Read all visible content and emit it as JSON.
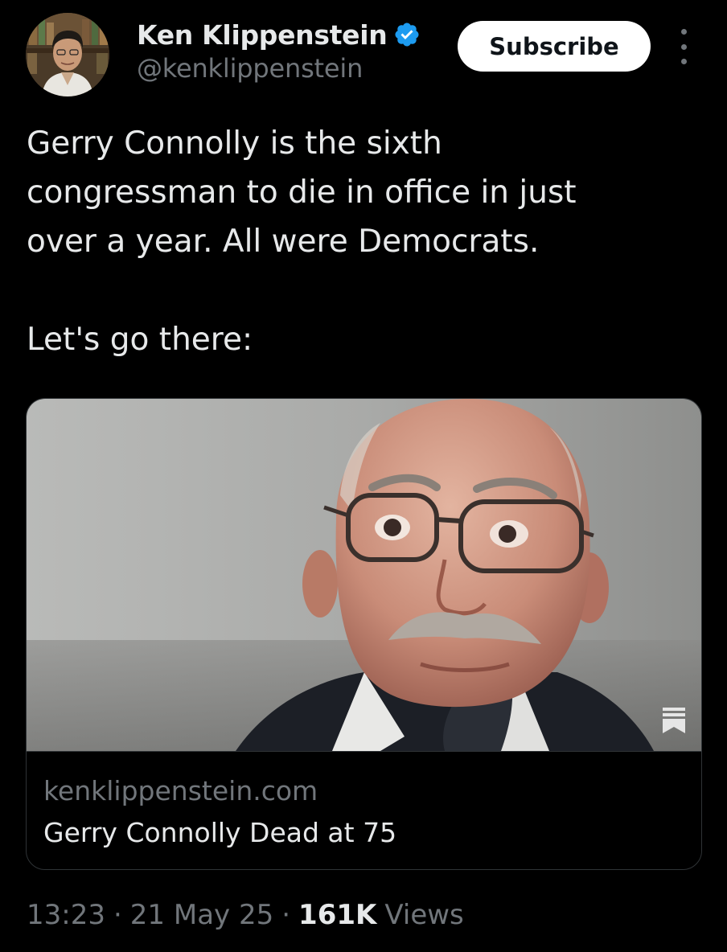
{
  "author": {
    "display_name": "Ken Klippenstein",
    "handle": "@kenklippenstein",
    "verified_icon": "verified-badge-icon",
    "avatar": "author-avatar"
  },
  "actions": {
    "subscribe_label": "Subscribe",
    "more_icon": "more-vertical-icon"
  },
  "tweet": {
    "text": "Gerry Connolly is the sixth\ncongressman to die in office in just\nover a year. All were Democrats.\n\nLet's go there:"
  },
  "link_card": {
    "image": "article-photo",
    "publisher_icon": "substack-icon",
    "domain": "kenklippenstein.com",
    "title": "Gerry Connolly Dead at 75"
  },
  "meta": {
    "time": "13:23",
    "separator": "·",
    "date": "21 May 25",
    "views_count": "161K",
    "views_label": "Views"
  },
  "colors": {
    "background": "#000000",
    "text_primary": "#e7e9ea",
    "text_secondary": "#71767b",
    "verified": "#1d9bf0",
    "border": "#2f3336",
    "button_bg": "#ffffff"
  }
}
